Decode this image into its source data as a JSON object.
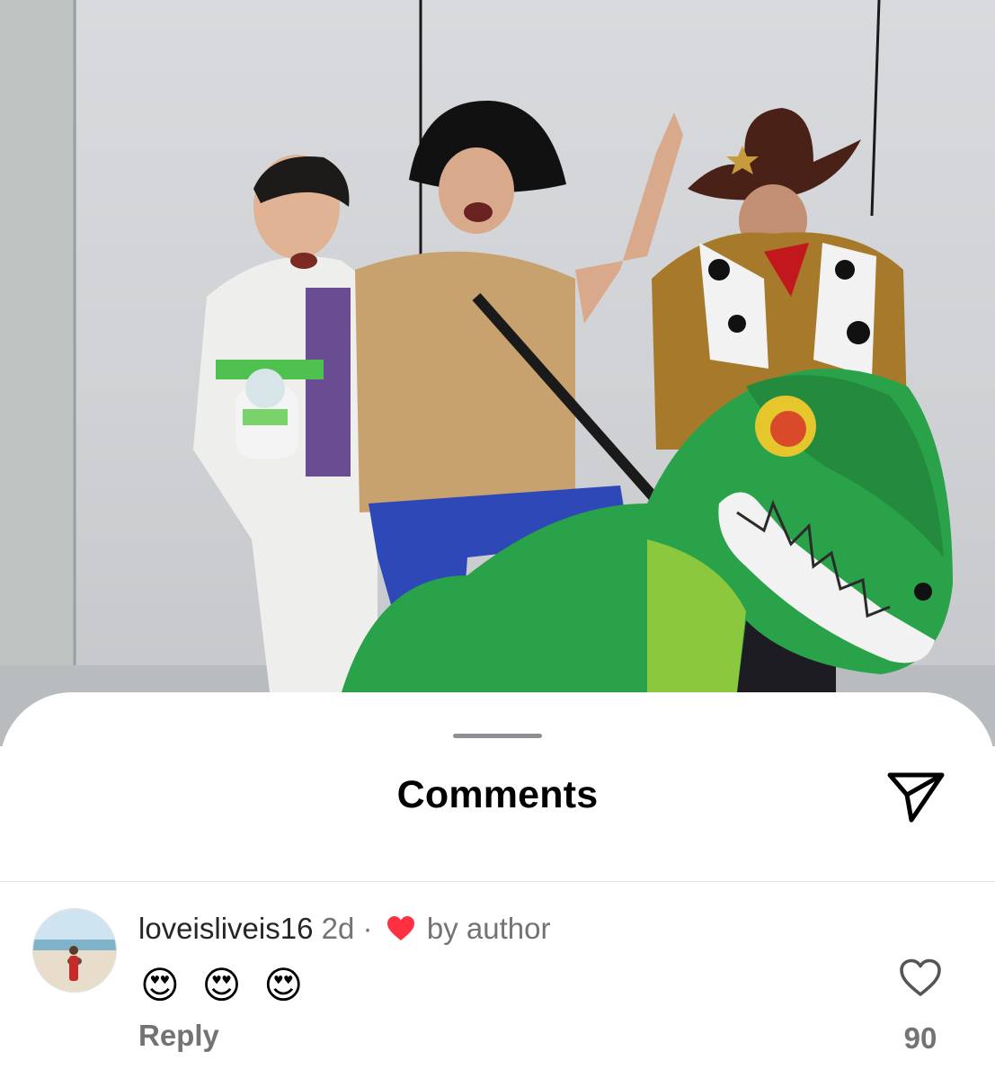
{
  "sheet": {
    "title": "Comments"
  },
  "comment": {
    "username": "loveisliveis16",
    "time": "2d",
    "separator": "·",
    "liked_by_author": "by author",
    "emojis": [
      "😍",
      "😍",
      "😍"
    ],
    "reply_label": "Reply",
    "like_count": "90"
  },
  "colors": {
    "heart_red": "#ff3040",
    "secondary_text": "#737373",
    "grabber": "#8e8e93"
  },
  "icons": {
    "share": "paper-plane-icon",
    "like": "heart-outline-icon",
    "author_like": "heart-filled-icon"
  }
}
